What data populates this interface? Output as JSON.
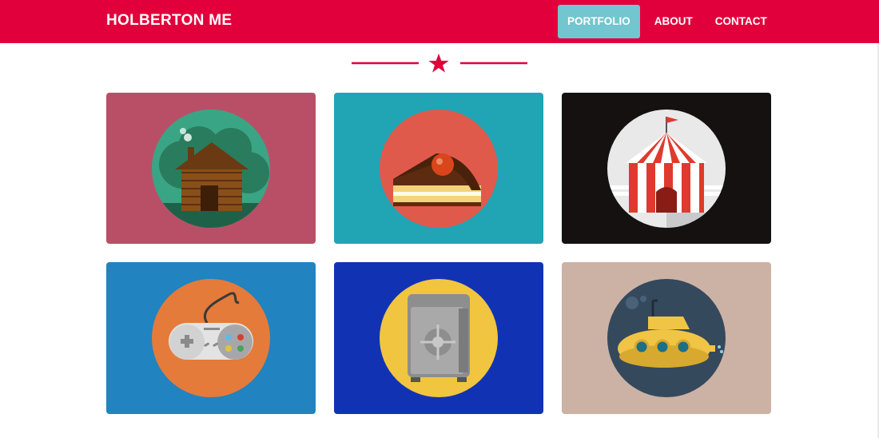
{
  "nav": {
    "brand": "HOLBERTON ME",
    "links": [
      {
        "label": "PORTFOLIO",
        "active": true
      },
      {
        "label": "ABOUT",
        "active": false
      },
      {
        "label": "CONTACT",
        "active": false
      }
    ]
  },
  "divider": {
    "icon": "star-icon",
    "color": "#e2003c"
  },
  "portfolio": [
    {
      "icon": "log-cabin-icon",
      "background": "#b94f66",
      "circle": "#3aa585"
    },
    {
      "icon": "cake-slice-icon",
      "background": "#21a4b4",
      "circle": "#e05a4c"
    },
    {
      "icon": "circus-tent-icon",
      "background": "#151111",
      "circle": "#e9e9ea"
    },
    {
      "icon": "game-controller-icon",
      "background": "#2183c0",
      "circle": "#e47b3a"
    },
    {
      "icon": "safe-icon",
      "background": "#1133b3",
      "circle": "#f1c53f"
    },
    {
      "icon": "submarine-icon",
      "background": "#ccb2a5",
      "circle": "#35495d"
    }
  ]
}
